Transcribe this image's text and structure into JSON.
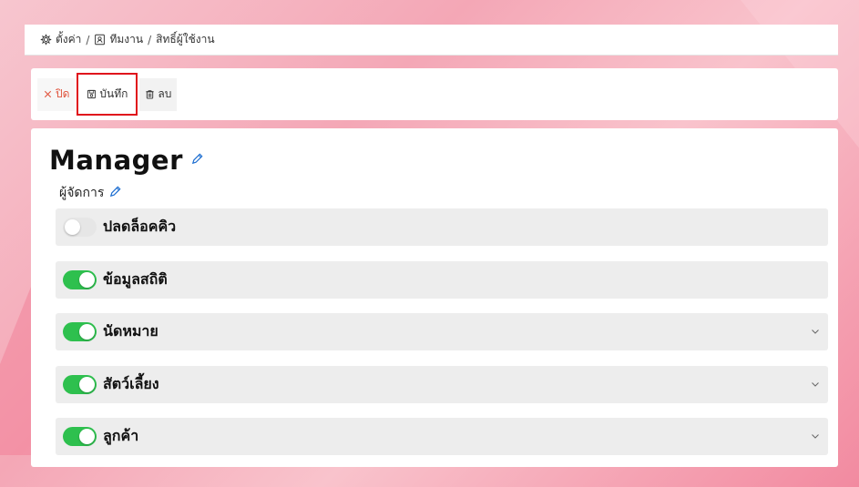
{
  "breadcrumb": {
    "items": [
      {
        "label": "ตั้งค่า",
        "icon": "gear-icon"
      },
      {
        "label": "ทีมงาน",
        "icon": "contact-card-icon"
      },
      {
        "label": "สิทธิ์ผู้ใช้งาน",
        "icon": ""
      }
    ],
    "separator": "/"
  },
  "toolbar": {
    "close_label": "ปิด",
    "save_label": "บันทึก",
    "delete_label": "ลบ"
  },
  "role": {
    "title": "Manager",
    "subtitle": "ผู้จัดการ"
  },
  "permissions": [
    {
      "label": "ปลดล็อคคิว",
      "enabled": false,
      "expandable": false
    },
    {
      "label": "ข้อมูลสถิติ",
      "enabled": true,
      "expandable": false
    },
    {
      "label": "นัดหมาย",
      "enabled": true,
      "expandable": true
    },
    {
      "label": "สัตว์เลี้ยง",
      "enabled": true,
      "expandable": true
    },
    {
      "label": "ลูกค้า",
      "enabled": true,
      "expandable": true
    }
  ],
  "colors": {
    "accent_green": "#2ec04e",
    "close_red": "#e0533c",
    "highlight_red": "#e0121b",
    "pencil_blue": "#1f6fd1"
  }
}
